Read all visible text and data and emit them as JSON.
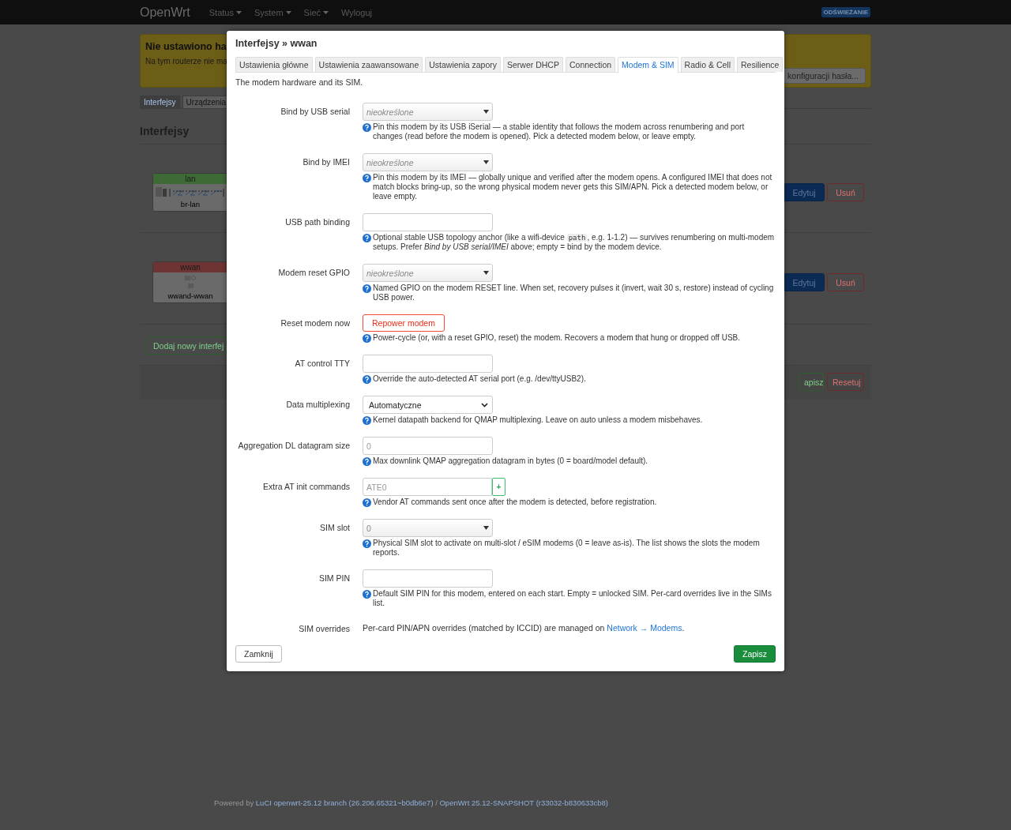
{
  "navbar": {
    "brand": "OpenWrt",
    "menu": [
      {
        "label": "Status",
        "dropdown": true
      },
      {
        "label": "System",
        "dropdown": true
      },
      {
        "label": "Sieć",
        "dropdown": true
      },
      {
        "label": "Wyloguj",
        "dropdown": false
      }
    ],
    "badge": "ODŚWIEŻANIE"
  },
  "background": {
    "alert": {
      "title": "Nie ustawiono ha",
      "text": "Na tym routerze nie ma",
      "button": "konfiguracji hasła..."
    },
    "tabs": [
      {
        "label": "Interfejsy",
        "selected": true
      },
      {
        "label": "Urządzenia",
        "selected": false
      }
    ],
    "heading": "Interfejsy",
    "interfaces": [
      {
        "name": "lan",
        "device": "br-lan",
        "color": "#3e6b35",
        "kind": "bridge",
        "buttons": [
          "Edytuj",
          "Usuń"
        ]
      },
      {
        "name": "wwan",
        "device": "wwand-wwan",
        "color": "#6e3434",
        "kind": "modem",
        "buttons": [
          "Edytuj",
          "Usuń"
        ]
      }
    ],
    "add_button": "Dodaj nowy interfej",
    "actions": [
      "apisz",
      "Resetuj"
    ]
  },
  "modal": {
    "title": "Interfejsy » wwan",
    "tabs": [
      {
        "label": "Ustawienia główne",
        "selected": false
      },
      {
        "label": "Ustawienia zaawansowane",
        "selected": false
      },
      {
        "label": "Ustawienia zapory",
        "selected": false
      },
      {
        "label": "Serwer DHCP",
        "selected": false
      },
      {
        "label": "Connection",
        "selected": false
      },
      {
        "label": "Modem & SIM",
        "selected": true
      },
      {
        "label": "Radio & Cell",
        "selected": false
      },
      {
        "label": "Resilience",
        "selected": false
      }
    ],
    "description": "The modem hardware and its SIM.",
    "fields": [
      {
        "label": "Bind by USB serial",
        "kind": "select",
        "placeholder": "nieokreślone",
        "help": "Pin this modem by its USB iSerial — a stable identity that follows the modem across renumbering and port changes (read before the modem is opened). Pick a detected modem below, or leave empty."
      },
      {
        "label": "Bind by IMEI",
        "kind": "select",
        "placeholder": "nieokreślone",
        "help": "Pin this modem by its IMEI — globally unique and verified after the modem opens. A configured IMEI that does not match blocks bring-up, so the wrong physical modem never gets this SIM/APN. Pick a detected modem below, or leave empty."
      },
      {
        "label": "USB path binding",
        "kind": "text",
        "help": "Optional stable USB topology anchor (like a wifi-device",
        "help_code": "path",
        "help_rest": ", e.g. 1-1.2) — survives renumbering on multi-modem setups. Prefer *Bind by USB serial/IMEI* above; empty = bind by the modem device."
      },
      {
        "label": "Modem reset GPIO",
        "kind": "select",
        "placeholder": "nieokreślone",
        "help": "Named GPIO on the modem RESET line. When set, recovery pulses it (invert, wait 30 s, restore) instead of cycling USB power."
      },
      {
        "label": "Reset modem now",
        "kind": "button",
        "button": "Repower modem",
        "help": "Power-cycle (or, with a reset GPIO, reset) the modem. Recovers a modem that hung or dropped off USB."
      },
      {
        "label": "AT control TTY",
        "kind": "text",
        "help": "Override the auto-detected AT serial port (e.g. /dev/ttyUSB2)."
      },
      {
        "label": "Data multiplexing",
        "kind": "native-select",
        "value": "Automatyczne",
        "help": "Kernel datapath backend for QMAP multiplexing. Leave on auto unless a modem misbehaves."
      },
      {
        "label": "Aggregation DL datagram size",
        "kind": "text",
        "placeholder": "0",
        "help": "Max downlink QMAP aggregation datagram in bytes (0 = board/model default)."
      },
      {
        "label": "Extra AT init commands",
        "kind": "dynlist",
        "placeholder": "ATE0",
        "add": "+",
        "help": "Vendor AT commands sent once after the modem is detected, before registration."
      },
      {
        "label": "SIM slot",
        "kind": "combo",
        "placeholder": "0",
        "help": "Physical SIM slot to activate on multi-slot / eSIM modems (0 = leave as-is). The list shows the slots the modem reports."
      },
      {
        "label": "SIM PIN",
        "kind": "text",
        "help": "Default SIM PIN for this modem, entered on each start. Empty = unlocked SIM. Per-card overrides live in the SIMs list."
      },
      {
        "label": "SIM overrides",
        "kind": "static",
        "text": "Per-card PIN/APN overrides (matched by ICCID) are managed on",
        "link": "Network → Modems",
        "after": "."
      }
    ],
    "close": "Zamknij",
    "save": "Zapisz"
  },
  "footer": {
    "text": "Powered by",
    "link1": "LuCI openwrt-25.12 branch (26.206.65321~b0db6e7)",
    "sep": "/",
    "link2": "OpenWrt 25.12-SNAPSHOT (r33032-b830633cb8)"
  }
}
